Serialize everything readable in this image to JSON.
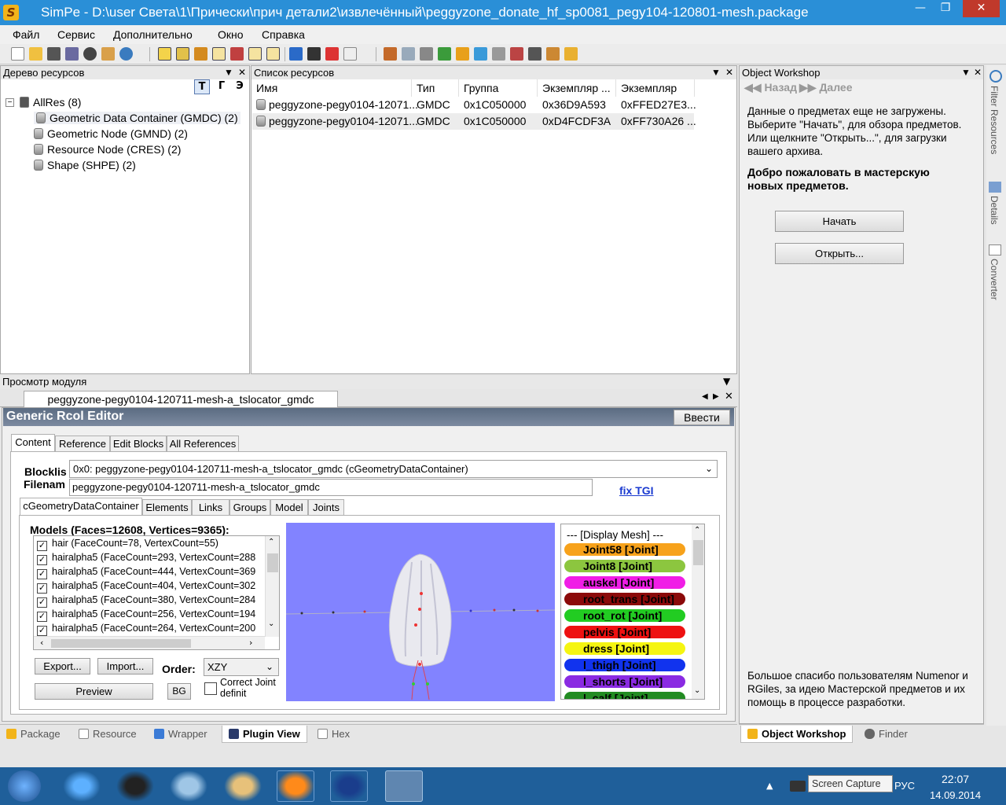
{
  "window": {
    "title": "SimPe - D:\\user Света\\1\\Прически\\прич детали2\\извлечённый\\peggyzone_donate_hf_sp0081_pegy104-120801-mesh.package",
    "app_icon": "S"
  },
  "menu": [
    "Файл",
    "Сервис",
    "Дополнительно",
    "Окно",
    "Справка"
  ],
  "resource_tree": {
    "header": "Дерево ресурсов",
    "filter_buttons": [
      "T",
      "Г",
      "Э"
    ],
    "root": "AllRes (8)",
    "items": [
      "Geometric Data Container (GMDC) (2)",
      "Geometric Node (GMND) (2)",
      "Resource Node (CRES) (2)",
      "Shape (SHPE) (2)"
    ]
  },
  "resource_list": {
    "header": "Список ресурсов",
    "columns": [
      "Имя",
      "Тип",
      "Группа",
      "Экземпляр ...",
      "Экземпляр"
    ],
    "rows": [
      [
        "peggyzone-pegy0104-12071...",
        "GMDC",
        "0x1C050000",
        "0x36D9A593",
        "0xFFED27E3..."
      ],
      [
        "peggyzone-pegy0104-12071...",
        "GMDC",
        "0x1C050000",
        "0xD4FCDF3A",
        "0xFF730A26 ..."
      ]
    ]
  },
  "object_workshop": {
    "header": "Object Workshop",
    "back": "Назад",
    "forward": "Далее",
    "info": "Данные о предметах еще не загружены. Выберите \"Начать\", для обзора предметов. Или щелкните \"Открыть...\", для загрузки вашего архива.",
    "welcome": "Добро пожаловать в мастерскую новых предметов.",
    "start_button": "Начать",
    "open_button": "Открыть...",
    "thanks": "Большое спасибо пользователям Numenor и RGiles, за идею Мастерской предметов и их помощь в процессе разработки."
  },
  "side_tabs": [
    "Filter Resources",
    "Details",
    "Converter"
  ],
  "plugin_view": {
    "header": "Просмотр модуля",
    "doc_tab": "peggyzone-pegy0104-120711-mesh-a_tslocator_gmdc",
    "editor_title": "Generic Rcol Editor",
    "commit_button": "Ввести",
    "tabs": [
      "Content",
      "Reference",
      "Edit Blocks",
      "All References"
    ],
    "blocklist_label": "Blocklis",
    "blocklist_value": "0x0: peggyzone-pegy0104-120711-mesh-a_tslocator_gmdc (cGeometryDataContainer)",
    "filename_label": "Filenam",
    "filename_value": "peggyzone-pegy0104-120711-mesh-a_tslocator_gmdc",
    "fix_tgi": "fix TGI",
    "inner_tabs": [
      "cGeometryDataContainer",
      "Elements",
      "Links",
      "Groups",
      "Model",
      "Joints"
    ],
    "models_label": "Models (Faces=12608, Vertices=9365):",
    "models": [
      "hair (FaceCount=78, VertexCount=55)",
      "hairalpha5 (FaceCount=293, VertexCount=288",
      "hairalpha5 (FaceCount=444, VertexCount=369",
      "hairalpha5 (FaceCount=404, VertexCount=302",
      "hairalpha5 (FaceCount=380, VertexCount=284",
      "hairalpha5 (FaceCount=256, VertexCount=194",
      "hairalpha5 (FaceCount=264, VertexCount=200"
    ],
    "export_button": "Export...",
    "import_button": "Import...",
    "order_label": "Order:",
    "order_value": "XZY",
    "preview_button": "Preview",
    "bg_button": "BG",
    "correct_joint_label": "Correct Joint definit",
    "display_mesh": "--- [Display Mesh] ---",
    "joints": [
      {
        "label": "Joint58 [Joint]",
        "color": "#f7a21b"
      },
      {
        "label": "Joint8 [Joint]",
        "color": "#8cc63f"
      },
      {
        "label": "auskel [Joint]",
        "color": "#f01de6"
      },
      {
        "label": "root_trans [Joint]",
        "color": "#8b0a0a"
      },
      {
        "label": "root_rot [Joint]",
        "color": "#22cc22"
      },
      {
        "label": "pelvis [Joint]",
        "color": "#ee1111"
      },
      {
        "label": "dress [Joint]",
        "color": "#f5f511"
      },
      {
        "label": "l_thigh [Joint]",
        "color": "#1133ee"
      },
      {
        "label": "l_shorts [Joint]",
        "color": "#8a2be2"
      },
      {
        "label": "l_calf [Joint]",
        "color": "#228b22"
      }
    ]
  },
  "bottom_tabs": [
    "Package",
    "Resource",
    "Wrapper",
    "Plugin View",
    "Hex"
  ],
  "bottom_right_tabs": [
    "Object Workshop",
    "Finder"
  ],
  "taskbar": {
    "language": "РУС",
    "time": "22:07",
    "date": "14.09.2014",
    "tooltip": "Screen Capture"
  }
}
